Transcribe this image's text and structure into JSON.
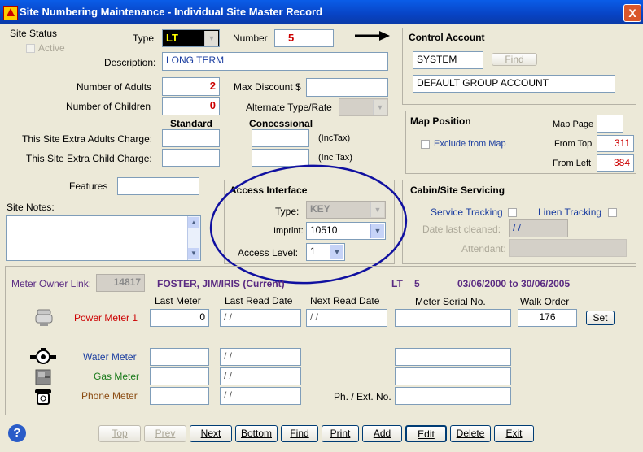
{
  "window": {
    "title": "Site Numbering Maintenance - Individual Site Master Record",
    "close": "X"
  },
  "site_status": {
    "label": "Site Status",
    "active_label": "Active"
  },
  "type": {
    "label": "Type",
    "value": "LT"
  },
  "number": {
    "label": "Number",
    "value": "5"
  },
  "description": {
    "label": "Description:",
    "value": "LONG TERM"
  },
  "adults": {
    "label": "Number of Adults",
    "value": "2"
  },
  "children": {
    "label": "Number of Children",
    "value": "0"
  },
  "max_discount": {
    "label": "Max Discount $",
    "value": ""
  },
  "alt_type": {
    "label": "Alternate Type/Rate",
    "value": ""
  },
  "charges": {
    "standard_label": "Standard",
    "concessional_label": "Concessional",
    "adults_label": "This Site Extra Adults Charge:",
    "child_label": "This Site Extra Child Charge:",
    "inctax1": "(IncTax)",
    "inctax2": "(Inc Tax)"
  },
  "features": {
    "label": "Features"
  },
  "site_notes": {
    "label": "Site Notes:"
  },
  "control_account": {
    "title": "Control Account",
    "code": "SYSTEM",
    "find": "Find",
    "name": "DEFAULT GROUP ACCOUNT"
  },
  "map_position": {
    "title": "Map Position",
    "map_page_label": "Map Page",
    "map_page": "",
    "exclude_label": "Exclude from Map",
    "from_top_label": "From Top",
    "from_top": "311",
    "from_left_label": "From Left",
    "from_left": "384"
  },
  "access": {
    "title": "Access Interface",
    "type_label": "Type:",
    "type_value": "KEY",
    "imprint_label": "Imprint:",
    "imprint_value": "10510",
    "level_label": "Access Level:",
    "level_value": "1"
  },
  "servicing": {
    "title": "Cabin/Site Servicing",
    "service_label": "Service Tracking",
    "linen_label": "Linen Tracking",
    "date_label": "Date last cleaned:",
    "date_value": "/ /",
    "attendant_label": "Attendant:"
  },
  "meter": {
    "owner_label": "Meter Owner Link:",
    "owner_id": "14817",
    "owner_name": "FOSTER, JIM/IRIS (Current)",
    "owner_type": "LT",
    "owner_num": "5",
    "owner_dates": "03/06/2000 to 30/06/2005",
    "col_last": "Last Meter",
    "col_lastread": "Last Read Date",
    "col_nextread": "Next Read Date",
    "col_serial": "Meter Serial No.",
    "col_walk": "Walk Order",
    "power_label": "Power Meter 1",
    "power_last": "0",
    "power_lastread": "/ /",
    "power_nextread": "/ /",
    "power_walk": "176",
    "set": "Set",
    "water_label": "Water Meter",
    "water_lastread": "/ /",
    "gas_label": "Gas Meter",
    "gas_lastread": "/ /",
    "phone_label": "Phone Meter",
    "phone_lastread": "/ /",
    "ph_ext_label": "Ph. / Ext. No."
  },
  "nav": {
    "help": "?",
    "top": "Top",
    "prev": "Prev",
    "next": "Next",
    "bottom": "Bottom",
    "find": "Find",
    "print": "Print",
    "add": "Add",
    "edit": "Edit",
    "delete": "Delete",
    "exit": "Exit"
  },
  "colors": {
    "annotation": "#1010a0",
    "title_bar": "#0843c4",
    "red_value": "#cc0000"
  },
  "icons": {
    "app": "app-logo-icon",
    "arrow": "arrow-right-icon",
    "power": "power-meter-icon",
    "water": "water-meter-icon",
    "gas": "gas-meter-icon",
    "phone": "phone-icon",
    "help": "help-icon"
  }
}
